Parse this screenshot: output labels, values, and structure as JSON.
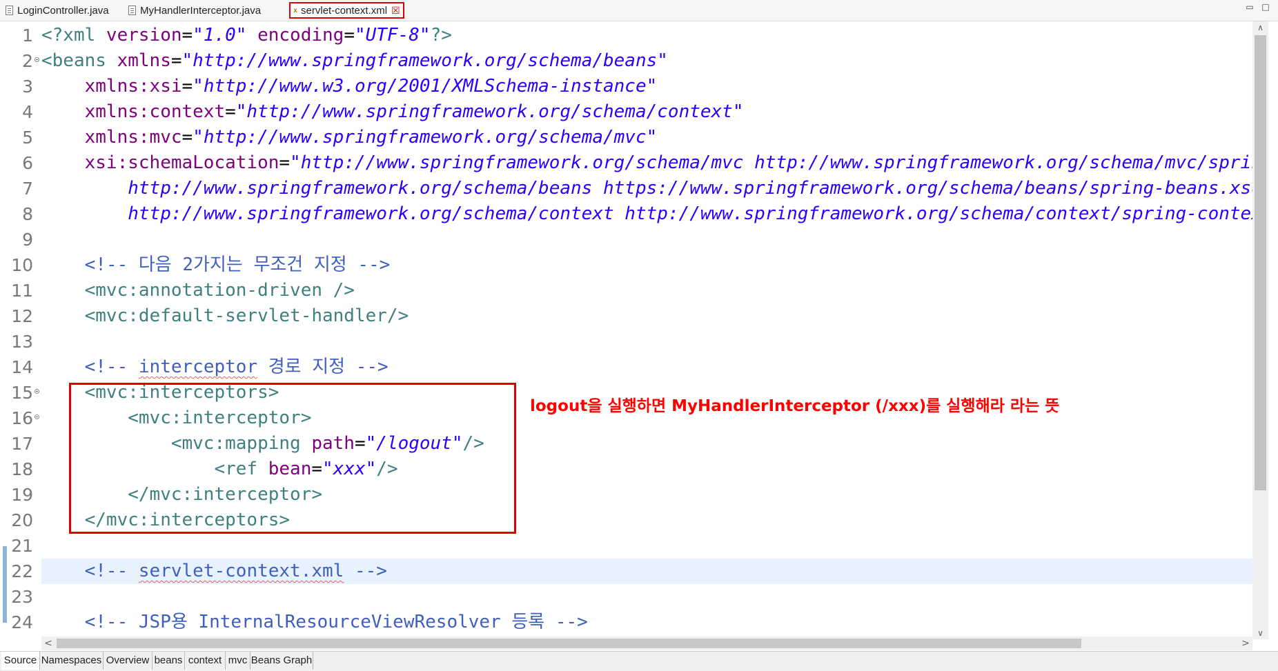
{
  "tabs": [
    {
      "label": "LoginController.java",
      "icon": "java-file-icon"
    },
    {
      "label": "MyHandlerInterceptor.java",
      "icon": "java-file-icon"
    },
    {
      "label": "servlet-context.xml",
      "icon": "xml-file-icon",
      "active": true
    }
  ],
  "window_controls": {
    "minimize": "▭",
    "maximize": "□"
  },
  "lines": [
    {
      "n": "1",
      "fold": false,
      "tokens": [
        [
          "t",
          "<?xml "
        ],
        [
          "a",
          "version"
        ],
        [
          "p",
          "="
        ],
        [
          "v",
          "\"1.0\""
        ],
        [
          "p",
          " "
        ],
        [
          "a",
          "encoding"
        ],
        [
          "p",
          "="
        ],
        [
          "v",
          "\"UTF-8\""
        ],
        [
          "t",
          "?>"
        ]
      ]
    },
    {
      "n": "2",
      "fold": true,
      "tokens": [
        [
          "t",
          "<beans "
        ],
        [
          "a",
          "xmlns"
        ],
        [
          "p",
          "="
        ],
        [
          "v",
          "\"http://www.springframework.org/schema/beans\""
        ]
      ]
    },
    {
      "n": "3",
      "fold": false,
      "tokens": [
        [
          "p",
          "    "
        ],
        [
          "a",
          "xmlns:xsi"
        ],
        [
          "p",
          "="
        ],
        [
          "v",
          "\"http://www.w3.org/2001/XMLSchema-instance\""
        ]
      ]
    },
    {
      "n": "4",
      "fold": false,
      "tokens": [
        [
          "p",
          "    "
        ],
        [
          "a",
          "xmlns:context"
        ],
        [
          "p",
          "="
        ],
        [
          "v",
          "\"http://www.springframework.org/schema/context\""
        ]
      ]
    },
    {
      "n": "5",
      "fold": false,
      "tokens": [
        [
          "p",
          "    "
        ],
        [
          "a",
          "xmlns:mvc"
        ],
        [
          "p",
          "="
        ],
        [
          "v",
          "\"http://www.springframework.org/schema/mvc\""
        ]
      ]
    },
    {
      "n": "6",
      "fold": false,
      "tokens": [
        [
          "p",
          "    "
        ],
        [
          "a",
          "xsi:schemaLocation"
        ],
        [
          "p",
          "="
        ],
        [
          "v",
          "\"http://www.springframework.org/schema/mvc http://www.springframework.org/schema/mvc/spring-mvc.xsd"
        ]
      ]
    },
    {
      "n": "7",
      "fold": false,
      "tokens": [
        [
          "p",
          "        "
        ],
        [
          "v",
          "http://www.springframework.org/schema/beans https://www.springframework.org/schema/beans/spring-beans.xsd"
        ]
      ]
    },
    {
      "n": "8",
      "fold": false,
      "tokens": [
        [
          "p",
          "        "
        ],
        [
          "v",
          "http://www.springframework.org/schema/context http://www.springframework.org/schema/context/spring-context.xsd\">"
        ]
      ]
    },
    {
      "n": "9",
      "fold": false,
      "tokens": []
    },
    {
      "n": "10",
      "fold": false,
      "tokens": [
        [
          "p",
          "    "
        ],
        [
          "c",
          "<!-- 다음 2가지는 무조건 지정 -->"
        ]
      ]
    },
    {
      "n": "11",
      "fold": false,
      "tokens": [
        [
          "p",
          "    "
        ],
        [
          "t",
          "<mvc:annotation-driven />"
        ]
      ]
    },
    {
      "n": "12",
      "fold": false,
      "tokens": [
        [
          "p",
          "    "
        ],
        [
          "t",
          "<mvc:default-servlet-handler/>"
        ]
      ]
    },
    {
      "n": "13",
      "fold": false,
      "tokens": []
    },
    {
      "n": "14",
      "fold": false,
      "tokens": [
        [
          "p",
          "    "
        ],
        [
          "c",
          "<!-- "
        ],
        [
          "cs",
          "interceptor"
        ],
        [
          "c",
          " 경로 지정 -->"
        ]
      ]
    },
    {
      "n": "15",
      "fold": true,
      "tokens": [
        [
          "p",
          "    "
        ],
        [
          "t",
          "<mvc:interceptors>"
        ]
      ]
    },
    {
      "n": "16",
      "fold": true,
      "tokens": [
        [
          "p",
          "        "
        ],
        [
          "t",
          "<mvc:interceptor>"
        ]
      ]
    },
    {
      "n": "17",
      "fold": false,
      "tokens": [
        [
          "p",
          "            "
        ],
        [
          "t",
          "<mvc:mapping "
        ],
        [
          "a",
          "path"
        ],
        [
          "p",
          "="
        ],
        [
          "v",
          "\"/logout\""
        ],
        [
          "t",
          "/>"
        ]
      ]
    },
    {
      "n": "18",
      "fold": false,
      "tokens": [
        [
          "p",
          "                "
        ],
        [
          "t",
          "<ref "
        ],
        [
          "a",
          "bean"
        ],
        [
          "p",
          "="
        ],
        [
          "v",
          "\"xxx\""
        ],
        [
          "t",
          "/>"
        ]
      ]
    },
    {
      "n": "19",
      "fold": false,
      "tokens": [
        [
          "p",
          "        "
        ],
        [
          "t",
          "</mvc:interceptor>"
        ]
      ]
    },
    {
      "n": "20",
      "fold": false,
      "tokens": [
        [
          "p",
          "    "
        ],
        [
          "t",
          "</mvc:interceptors>"
        ]
      ]
    },
    {
      "n": "21",
      "fold": false,
      "tokens": []
    },
    {
      "n": "22",
      "fold": false,
      "current": true,
      "tokens": [
        [
          "p",
          "    "
        ],
        [
          "c",
          "<!-- "
        ],
        [
          "cs",
          "servlet-context.xml"
        ],
        [
          "c",
          " -->"
        ]
      ]
    },
    {
      "n": "23",
      "fold": false,
      "tokens": []
    },
    {
      "n": "24",
      "fold": false,
      "tokens": [
        [
          "p",
          "    "
        ],
        [
          "c",
          "<!-- JSP용 InternalResourceViewResolver 등록 -->"
        ]
      ]
    }
  ],
  "annotation": {
    "text": "logout을 실행하면 MyHandlerInterceptor (/xxx)를 실행해라 라는 뜻",
    "color": "#ff0000"
  },
  "colors": {
    "tag": "#3f7f7f",
    "attr": "#7f007f",
    "value": "#2a00ff",
    "comment": "#3f5fbf",
    "highlight": "#e00000",
    "current_line": "#e8f2fe"
  },
  "scroll": {
    "up": "∧",
    "down": "∨",
    "left": "<",
    "right": ">"
  },
  "bottom_tabs": [
    "Source",
    "Namespaces",
    "Overview",
    "beans",
    "context",
    "mvc",
    "Beans Graph"
  ]
}
